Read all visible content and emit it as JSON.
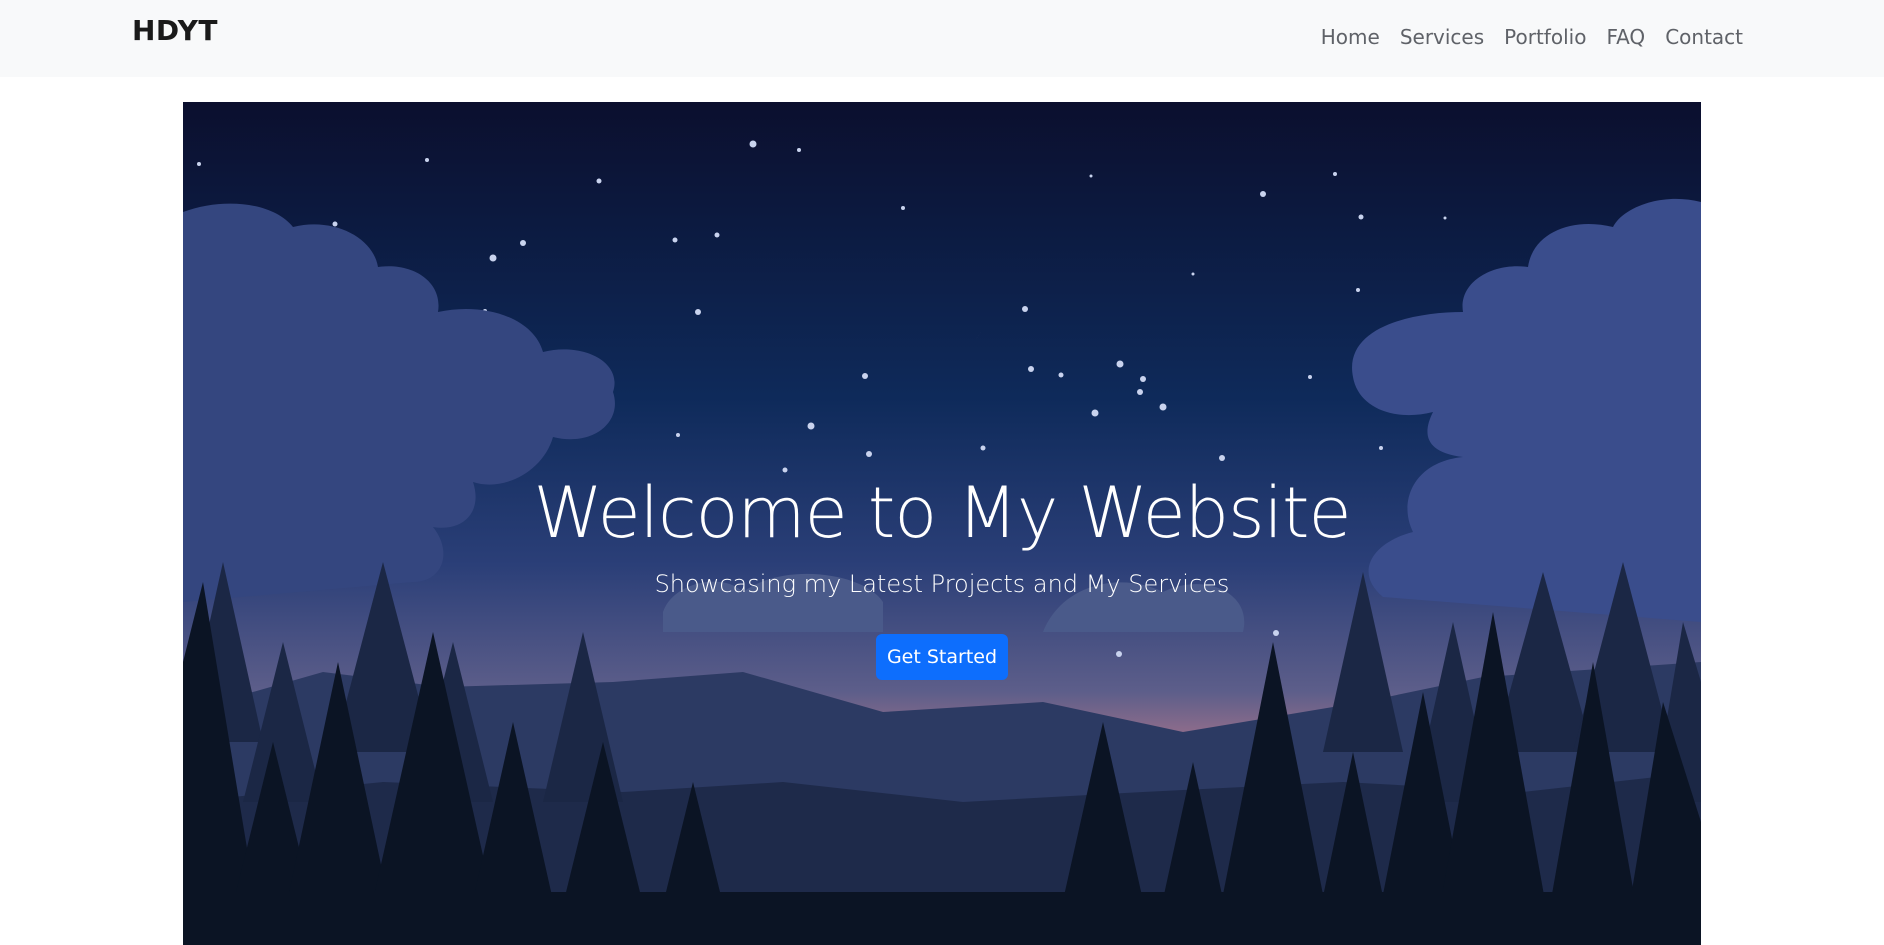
{
  "navbar": {
    "brand": "HDYT",
    "links": [
      {
        "label": "Home"
      },
      {
        "label": "Services"
      },
      {
        "label": "Portfolio"
      },
      {
        "label": "FAQ"
      },
      {
        "label": "Contact"
      }
    ]
  },
  "hero": {
    "title": "Welcome to My Website",
    "subtitle": "Showcasing my Latest Projects and My Services",
    "cta_label": "Get Started",
    "colors": {
      "sky_top": "#0b0f2e",
      "sky_mid": "#0e2a5a",
      "horizon": "#c07b8c",
      "cloud": "#3b4e8a",
      "mountain_far": "#2c3a63",
      "mountain_near": "#1e2a4a",
      "tree_back": "#1b2745",
      "tree_front": "#0b1424",
      "moon": "#e3e7ef",
      "button": "#0d6efd"
    }
  }
}
